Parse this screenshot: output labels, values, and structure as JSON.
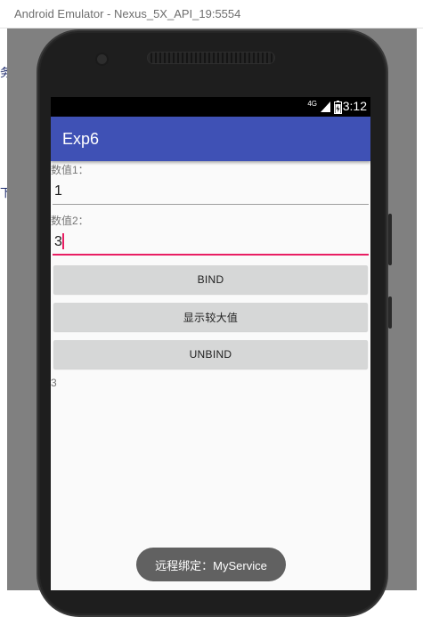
{
  "window": {
    "title": "Android Emulator - Nexus_5X_API_19:5554"
  },
  "background_fragments": [
    "务",
    "下"
  ],
  "status_bar": {
    "network": "4G",
    "time": "3:12"
  },
  "app": {
    "title": "Exp6",
    "accent_color": "#3f51b5",
    "focus_color": "#e91e63"
  },
  "form": {
    "value1_label": "数值1：",
    "value1": "1",
    "value2_label": "数值2：",
    "value2": "3"
  },
  "buttons": {
    "bind": "BIND",
    "show_max": "显示较大值",
    "unbind": "UNBIND"
  },
  "result": "3",
  "toast": "远程绑定：MyService"
}
